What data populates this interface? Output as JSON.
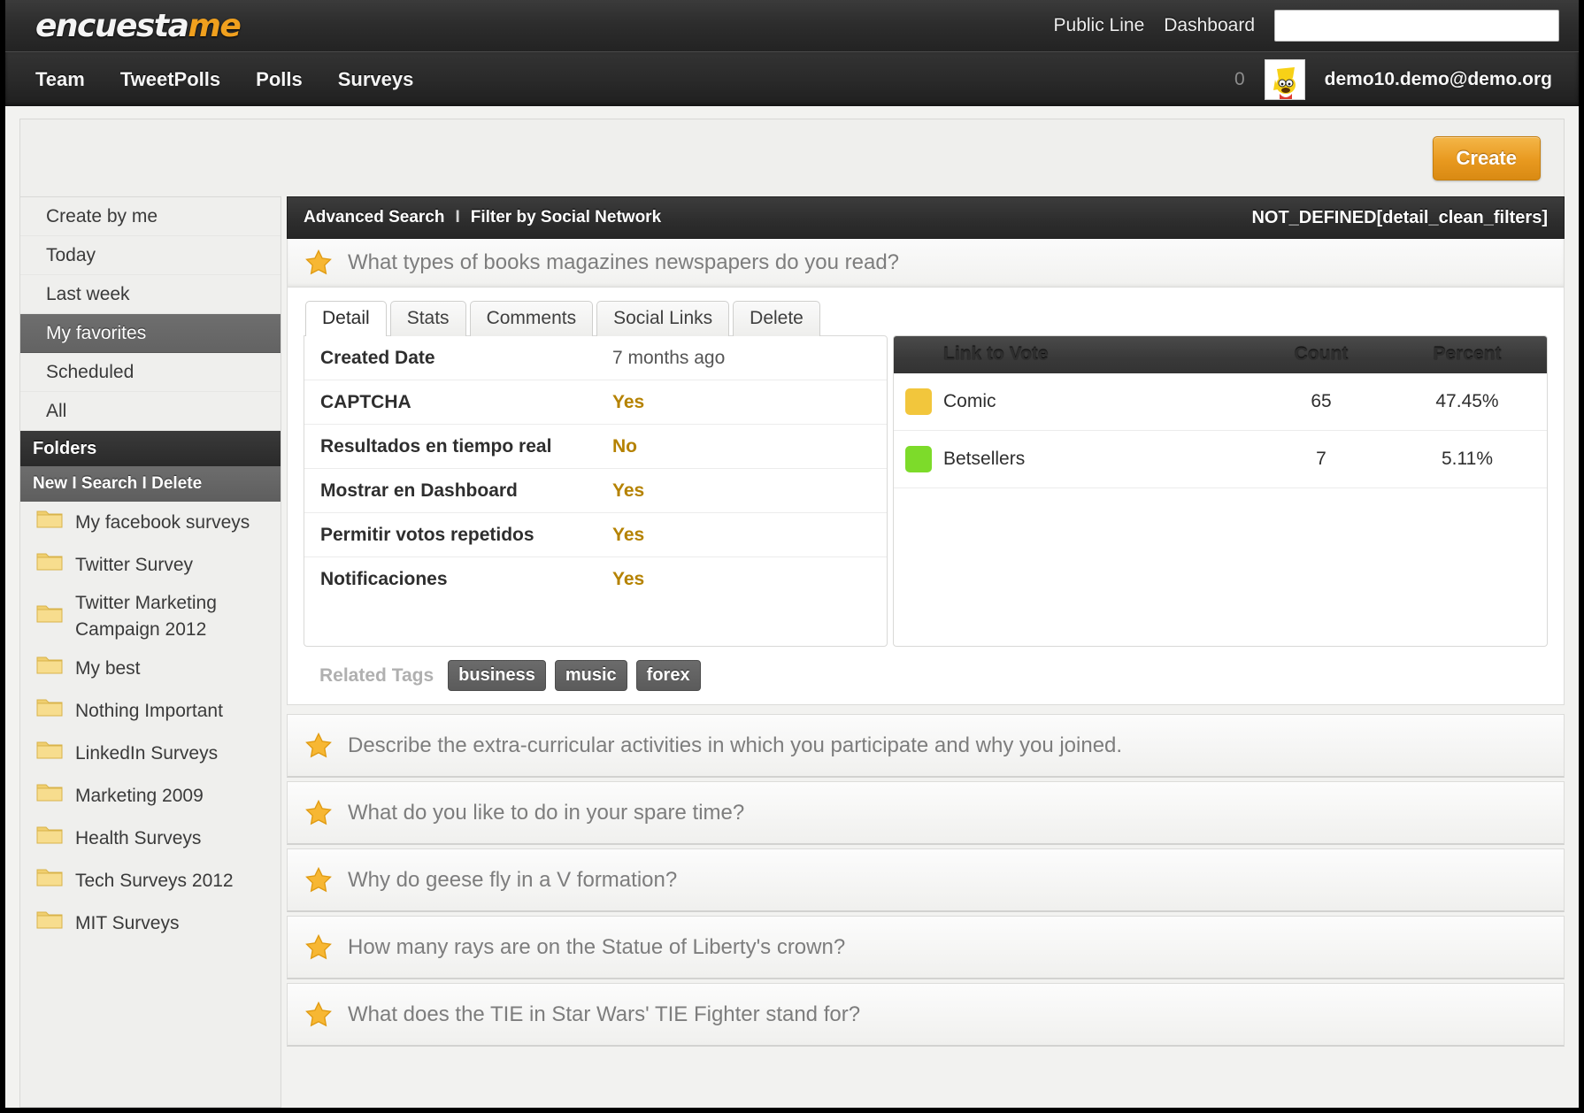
{
  "brand": {
    "name_dark": "encuesta",
    "name_accent": "me"
  },
  "topbar": {
    "links": [
      {
        "label": "Public Line",
        "name": "public-line"
      },
      {
        "label": "Dashboard",
        "name": "dashboard"
      }
    ],
    "search": {
      "value": "",
      "placeholder": ""
    }
  },
  "nav": {
    "items": [
      {
        "label": "Team"
      },
      {
        "label": "TweetPolls"
      },
      {
        "label": "Polls"
      },
      {
        "label": "Surveys"
      }
    ],
    "notification_count": "0",
    "user_email": "demo10.demo@demo.org"
  },
  "toolbar": {
    "create_label": "Create"
  },
  "sidebar": {
    "items": [
      {
        "label": "Create by me",
        "active": false
      },
      {
        "label": "Today",
        "active": false
      },
      {
        "label": "Last week",
        "active": false
      },
      {
        "label": "My favorites",
        "active": true
      },
      {
        "label": "Scheduled",
        "active": false
      },
      {
        "label": "All",
        "active": false
      }
    ],
    "folders_header": "Folders",
    "folder_actions": "New I Search I Delete",
    "folders": [
      {
        "label": "My facebook surveys"
      },
      {
        "label": "Twitter Survey"
      },
      {
        "label": "Twitter Marketing Campaign 2012"
      },
      {
        "label": "My best"
      },
      {
        "label": "Nothing Important"
      },
      {
        "label": "LinkedIn Surveys"
      },
      {
        "label": "Marketing 2009"
      },
      {
        "label": "Health Surveys"
      },
      {
        "label": "Tech Surveys 2012"
      },
      {
        "label": "MIT Surveys"
      }
    ]
  },
  "filter_bar": {
    "advanced_search": "Advanced Search",
    "separator": "I",
    "filter_social": "Filter by Social Network",
    "right_label": "NOT_DEFINED[detail_clean_filters]"
  },
  "selected_question": {
    "title": "What types of books magazines newspapers do you read?"
  },
  "tabs": [
    {
      "label": "Detail",
      "active": true
    },
    {
      "label": "Stats",
      "active": false
    },
    {
      "label": "Comments",
      "active": false
    },
    {
      "label": "Social Links",
      "active": false
    },
    {
      "label": "Delete",
      "active": false
    }
  ],
  "detail_rows": [
    {
      "label": "Created Date",
      "value": "7 months ago",
      "highlight": false
    },
    {
      "label": "CAPTCHA",
      "value": "Yes",
      "highlight": true
    },
    {
      "label": "Resultados en tiempo real",
      "value": "No",
      "highlight": true
    },
    {
      "label": "Mostrar en Dashboard",
      "value": "Yes",
      "highlight": true
    },
    {
      "label": "Permitir votos repetidos",
      "value": "Yes",
      "highlight": true
    },
    {
      "label": "Notificaciones",
      "value": "Yes",
      "highlight": true
    }
  ],
  "results": {
    "headers": {
      "link": "Link to Vote",
      "count": "Count",
      "percent": "Percent"
    },
    "rows": [
      {
        "label": "Comic",
        "count": "65",
        "percent": "47.45%",
        "color": "#f2c63c"
      },
      {
        "label": "Betsellers",
        "count": "7",
        "percent": "5.11%",
        "color": "#7ddb2a"
      }
    ]
  },
  "related_tags": {
    "label": "Related Tags",
    "tags": [
      {
        "label": "business"
      },
      {
        "label": "music"
      },
      {
        "label": "forex"
      }
    ]
  },
  "question_list": [
    {
      "text": "Describe the extra-curricular activities in which you participate and why you joined."
    },
    {
      "text": "What do you like to do in your spare time?"
    },
    {
      "text": "Why do geese fly in a V formation?"
    },
    {
      "text": "How many rays are on the Statue of Liberty's crown?"
    },
    {
      "text": "What does the TIE in Star Wars' TIE Fighter stand for?"
    }
  ],
  "colors": {
    "accent": "#f0a01e",
    "dark": "#2d2d2d",
    "value_highlight": "#b58200"
  }
}
